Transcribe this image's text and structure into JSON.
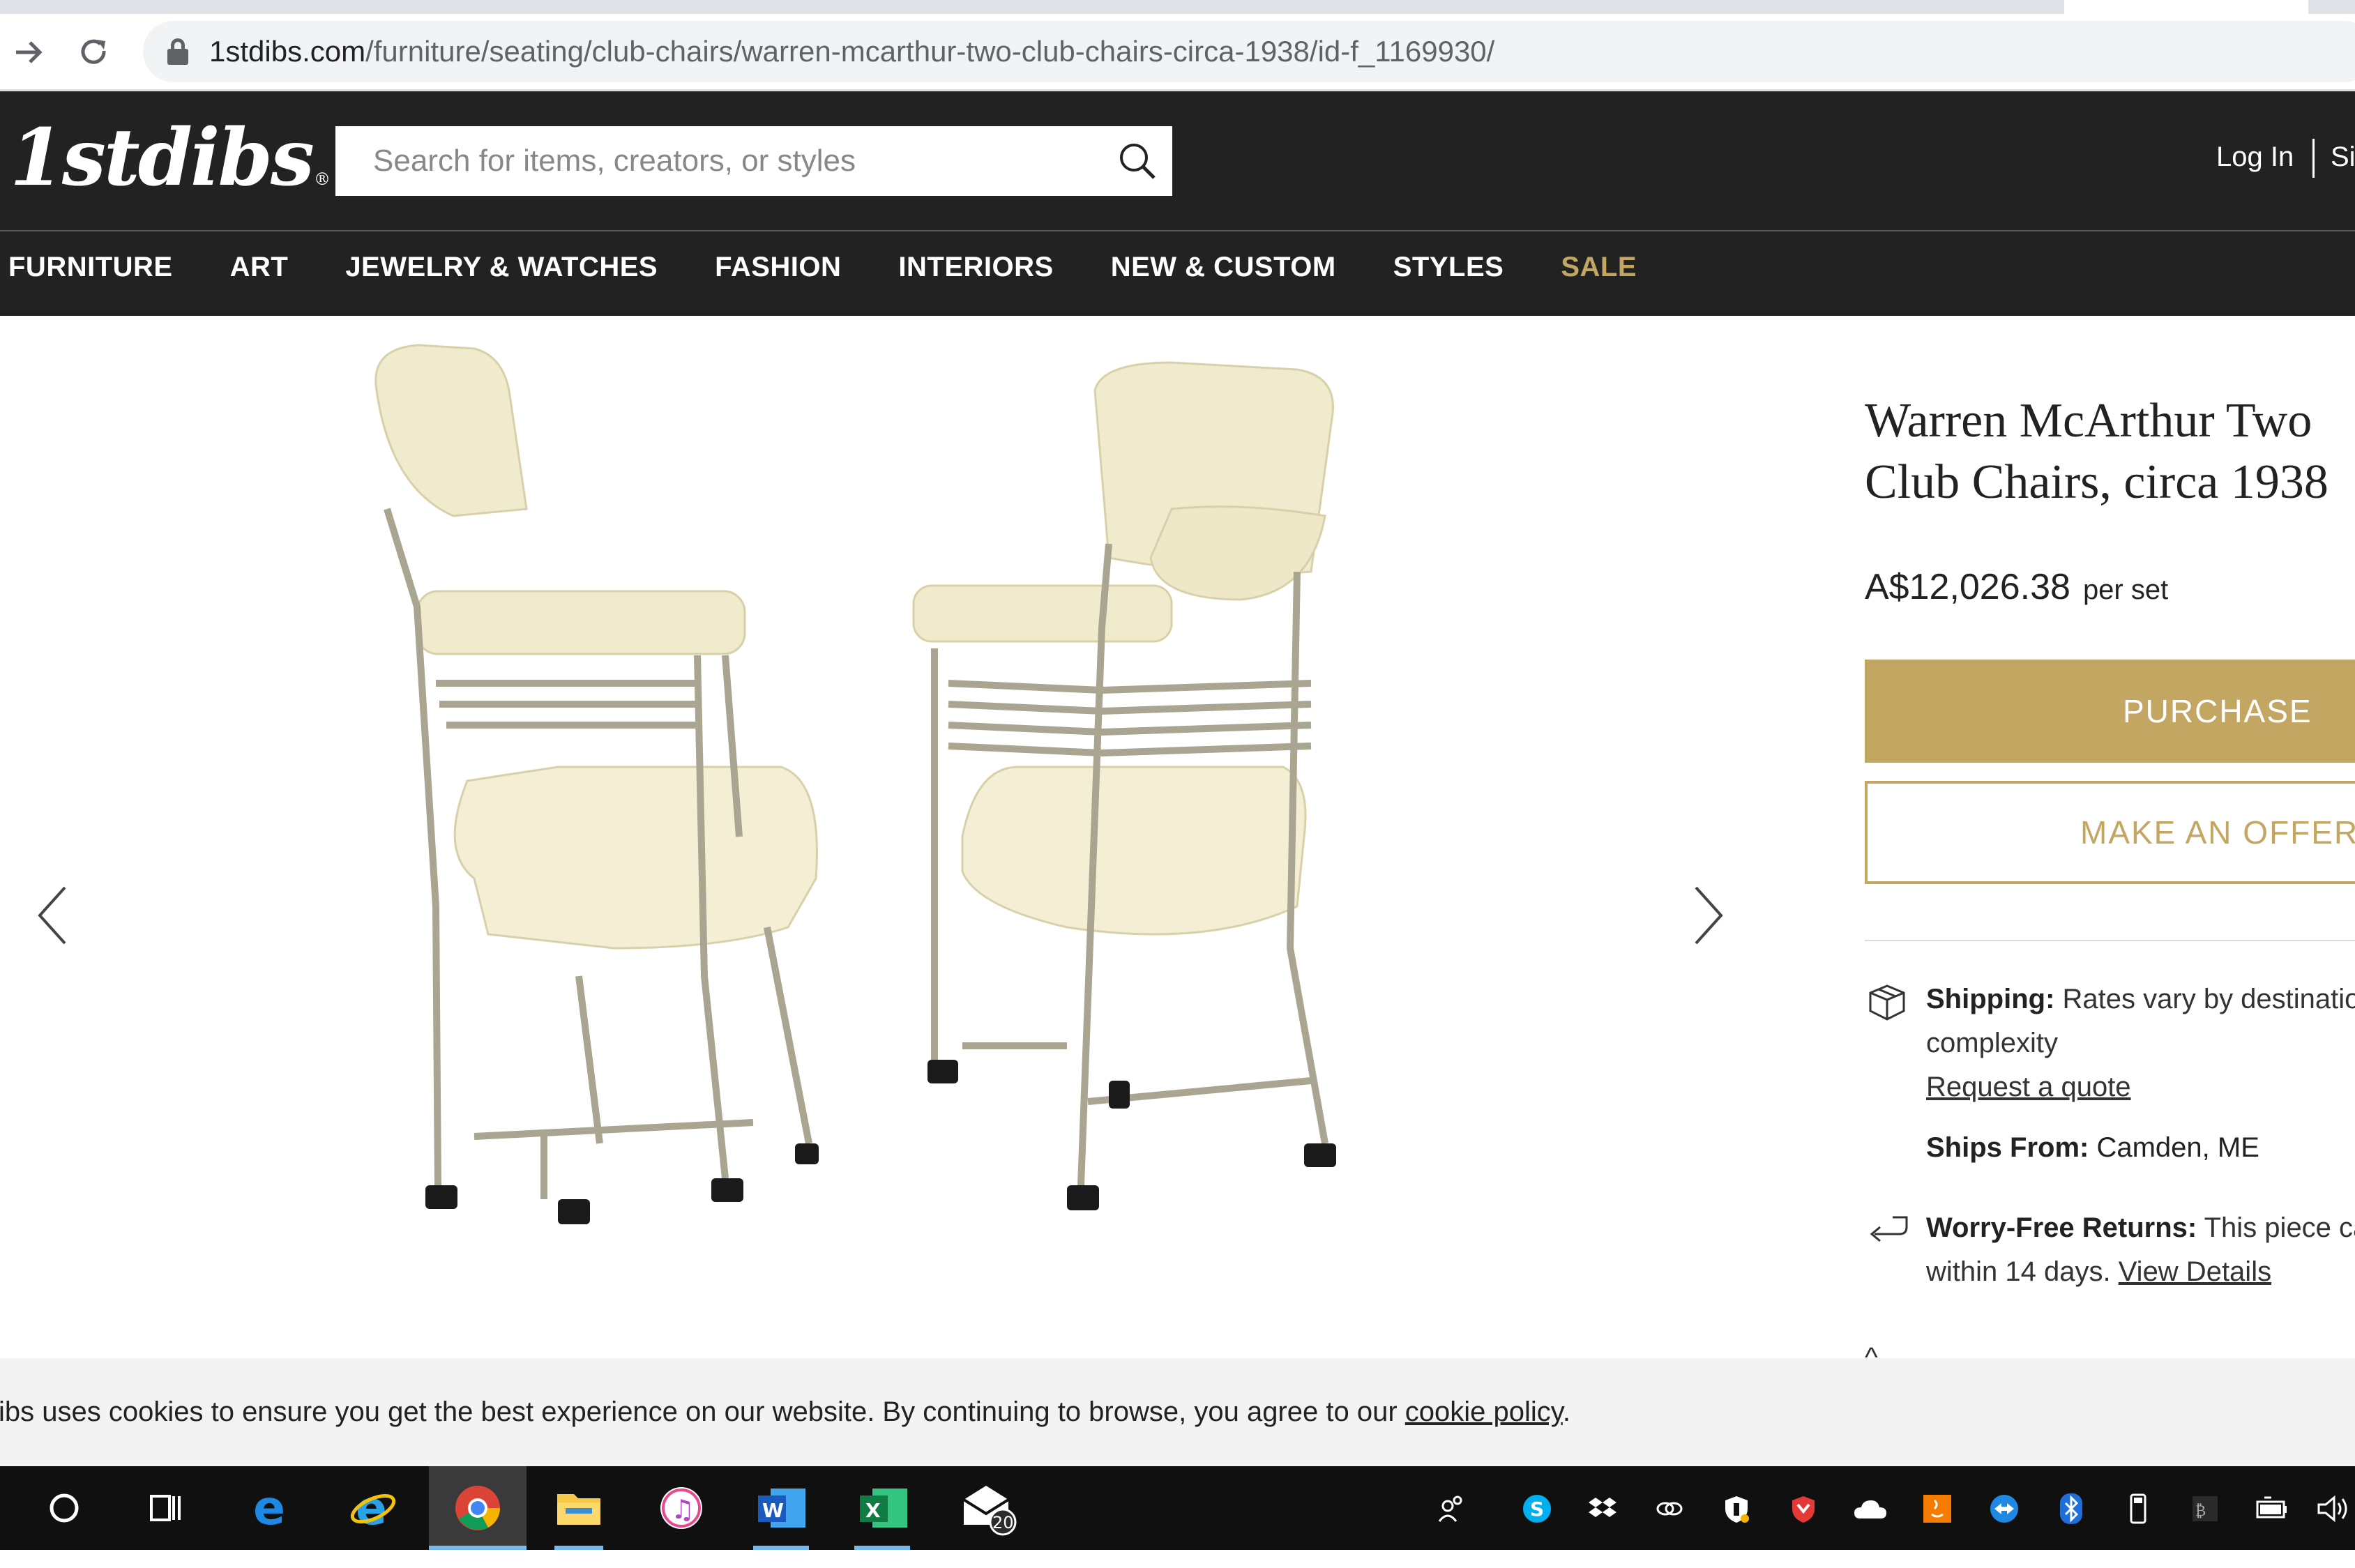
{
  "browser": {
    "url_domain": "1stdibs.com",
    "url_path": "/furniture/seating/club-chairs/warren-mcarthur-two-club-chairs-circa-1938/id-f_1169930/"
  },
  "header": {
    "logo": "1stdibs",
    "logo_mark": "®",
    "search_placeholder": "Search for items, creators, or styles",
    "login_label": "Log In",
    "signup_label": "Si",
    "nav": [
      {
        "label": "FURNITURE"
      },
      {
        "label": "ART"
      },
      {
        "label": "JEWELRY & WATCHES"
      },
      {
        "label": "FASHION"
      },
      {
        "label": "INTERIORS"
      },
      {
        "label": "NEW & CUSTOM"
      },
      {
        "label": "STYLES"
      },
      {
        "label": "SALE"
      }
    ]
  },
  "product": {
    "title_line1": "Warren McArthur Two",
    "title_line2": "Club Chairs, circa 1938",
    "price": "A$12,026.38",
    "price_unit": "per set",
    "purchase_label": "PURCHASE",
    "offer_label": "MAKE AN OFFER",
    "shipping_label": "Shipping:",
    "shipping_text": "Rates vary by destinatio",
    "shipping_text2": "complexity",
    "request_quote": "Request a quote",
    "ships_from_label": "Ships From:",
    "ships_from_value": "Camden, ME",
    "returns_label": "Worry-Free Returns:",
    "returns_text": "This piece ca",
    "returns_text2": "within 14 days.",
    "view_details": "View Details",
    "chevron_up": "^"
  },
  "cookie": {
    "text": "ibs uses cookies to ensure you get the best experience on our website. By continuing to browse, you agree to our",
    "link": "cookie policy",
    "end": "."
  },
  "taskbar": {
    "mail_badge": "20",
    "colors": {
      "chrome_active": "#3a3a3a",
      "underline": "#76b9ed",
      "gold": "#c2a661"
    }
  }
}
